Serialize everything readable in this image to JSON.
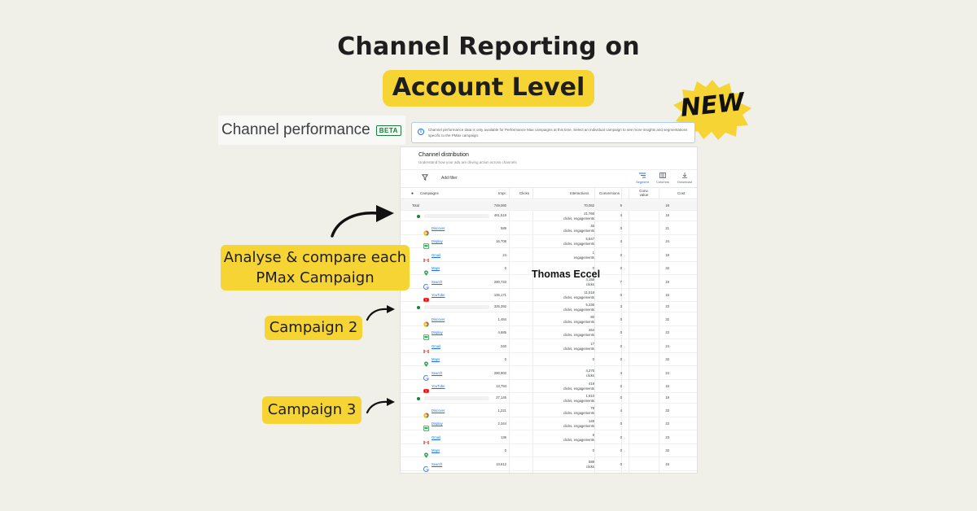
{
  "headline": {
    "line1": "Channel Reporting on",
    "line2": "Account Level",
    "badge": "NEW"
  },
  "colors": {
    "accent": "#f6d433",
    "background": "#f0efe8",
    "link": "#1a73e8",
    "status_green": "#188038"
  },
  "panel": {
    "title": "Channel performance",
    "beta": "BETA",
    "info_banner": "Channel performance data is only available for Performance Max campaigns at this time. Select an individual campaign to see more insights and segmentations specific to the PMax campaign.",
    "distribution_title": "Channel distribution",
    "distribution_subtitle": "Understand how your ads are driving action across channels",
    "add_filter": "Add filter",
    "tools": {
      "segment": "Segment",
      "columns": "Columns",
      "download": "Download"
    },
    "columns": [
      "Campaigns",
      "Impr.",
      "Clicks",
      "Interactions",
      "Conversions",
      "Conv. value",
      "Cost"
    ],
    "total": {
      "label": "Total",
      "impr": "749,060",
      "interactions": "70,062",
      "conversions": "9",
      "cost": "18"
    },
    "campaigns": [
      {
        "impr": "461,519",
        "interactions": "21,766",
        "interactions_sub": "clicks, engagements",
        "conversions": "4",
        "cost": "16",
        "channels": [
          {
            "name": "Discover",
            "icon": "discover-icon",
            "impr": "589",
            "interactions": "46",
            "sub": "clicks, engagements",
            "conv": "0",
            "cost": "21"
          },
          {
            "name": "Display",
            "icon": "display-icon",
            "impr": "16,708",
            "interactions": "5,647",
            "sub": "clicks, engagements",
            "conv": "4",
            "cost": "24"
          },
          {
            "name": "Gmail",
            "icon": "gmail-icon",
            "impr": "24",
            "interactions": "1",
            "sub": "engagements",
            "conv": "0",
            "cost": "19"
          },
          {
            "name": "Maps",
            "icon": "maps-icon",
            "impr": "0",
            "interactions": "0",
            "sub": "",
            "conv": "0",
            "cost": "32"
          },
          {
            "name": "Search",
            "icon": "search-g-icon",
            "impr": "280,733",
            "interactions": "4,158",
            "sub": "clicks",
            "conv": "7",
            "cost": "19"
          },
          {
            "name": "YouTube",
            "icon": "youtube-icon",
            "impr": "146,171",
            "interactions": "11,518",
            "sub": "clicks, engagements",
            "conv": "0",
            "cost": "16"
          }
        ]
      },
      {
        "impr": "325,392",
        "interactions": "5,236",
        "interactions_sub": "clicks, engagements",
        "conversions": "3",
        "cost": "23",
        "channels": [
          {
            "name": "Discover",
            "icon": "discover-icon",
            "impr": "1,484",
            "interactions": "80",
            "sub": "clicks, engagements",
            "conv": "0",
            "cost": "32"
          },
          {
            "name": "Display",
            "icon": "display-icon",
            "impr": "4,685",
            "interactions": "464",
            "sub": "clicks, engagements",
            "conv": "0",
            "cost": "23"
          },
          {
            "name": "Gmail",
            "icon": "gmail-icon",
            "impr": "340",
            "interactions": "17",
            "sub": "clicks, engagements",
            "conv": "0",
            "cost": "24"
          },
          {
            "name": "Maps",
            "icon": "maps-icon",
            "impr": "0",
            "interactions": "0",
            "sub": "",
            "conv": "0",
            "cost": "32"
          },
          {
            "name": "Search",
            "icon": "search-g-icon",
            "impr": "280,903",
            "interactions": "4,275",
            "sub": "clicks",
            "conv": "4",
            "cost": "24"
          },
          {
            "name": "YouTube",
            "icon": "youtube-icon",
            "impr": "13,794",
            "interactions": "419",
            "sub": "clicks, engagements",
            "conv": "2",
            "cost": "16"
          }
        ]
      },
      {
        "impr": "27,145",
        "interactions": "1,810",
        "interactions_sub": "clicks, engagements",
        "conversions": "0",
        "cost": "19",
        "channels": [
          {
            "name": "Discover",
            "icon": "discover-icon",
            "impr": "1,221",
            "interactions": "78",
            "sub": "clicks, engagements",
            "conv": "4",
            "cost": "33"
          },
          {
            "name": "Display",
            "icon": "display-icon",
            "impr": "2,344",
            "interactions": "148",
            "sub": "clicks, engagements",
            "conv": "0",
            "cost": "23"
          },
          {
            "name": "Gmail",
            "icon": "gmail-icon",
            "impr": "136",
            "interactions": "8",
            "sub": "clicks, engagements",
            "conv": "0",
            "cost": "23"
          },
          {
            "name": "Maps",
            "icon": "maps-icon",
            "impr": "0",
            "interactions": "0",
            "sub": "",
            "conv": "0",
            "cost": "32"
          },
          {
            "name": "Search",
            "icon": "search-g-icon",
            "impr": "13,612",
            "interactions": "588",
            "sub": "clicks",
            "conv": "0",
            "cost": "15"
          }
        ]
      }
    ]
  },
  "watermark": "Thomas Eccel",
  "annotations": {
    "label1_line1": "Analyse & compare each",
    "label1_line2": "PMax Campaign",
    "label2": "Campaign 2",
    "label3": "Campaign 3"
  }
}
